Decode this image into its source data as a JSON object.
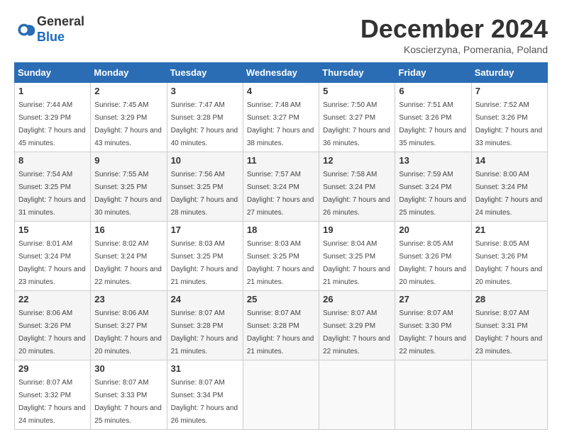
{
  "header": {
    "logo": {
      "line1": "General",
      "line2": "Blue"
    },
    "title": "December 2024",
    "subtitle": "Koscierzyna, Pomerania, Poland"
  },
  "weekdays": [
    "Sunday",
    "Monday",
    "Tuesday",
    "Wednesday",
    "Thursday",
    "Friday",
    "Saturday"
  ],
  "weeks": [
    [
      {
        "day": "1",
        "sunrise": "7:44 AM",
        "sunset": "3:29 PM",
        "daylight": "7 hours and 45 minutes."
      },
      {
        "day": "2",
        "sunrise": "7:45 AM",
        "sunset": "3:29 PM",
        "daylight": "7 hours and 43 minutes."
      },
      {
        "day": "3",
        "sunrise": "7:47 AM",
        "sunset": "3:28 PM",
        "daylight": "7 hours and 40 minutes."
      },
      {
        "day": "4",
        "sunrise": "7:48 AM",
        "sunset": "3:27 PM",
        "daylight": "7 hours and 38 minutes."
      },
      {
        "day": "5",
        "sunrise": "7:50 AM",
        "sunset": "3:27 PM",
        "daylight": "7 hours and 36 minutes."
      },
      {
        "day": "6",
        "sunrise": "7:51 AM",
        "sunset": "3:26 PM",
        "daylight": "7 hours and 35 minutes."
      },
      {
        "day": "7",
        "sunrise": "7:52 AM",
        "sunset": "3:26 PM",
        "daylight": "7 hours and 33 minutes."
      }
    ],
    [
      {
        "day": "8",
        "sunrise": "7:54 AM",
        "sunset": "3:25 PM",
        "daylight": "7 hours and 31 minutes."
      },
      {
        "day": "9",
        "sunrise": "7:55 AM",
        "sunset": "3:25 PM",
        "daylight": "7 hours and 30 minutes."
      },
      {
        "day": "10",
        "sunrise": "7:56 AM",
        "sunset": "3:25 PM",
        "daylight": "7 hours and 28 minutes."
      },
      {
        "day": "11",
        "sunrise": "7:57 AM",
        "sunset": "3:24 PM",
        "daylight": "7 hours and 27 minutes."
      },
      {
        "day": "12",
        "sunrise": "7:58 AM",
        "sunset": "3:24 PM",
        "daylight": "7 hours and 26 minutes."
      },
      {
        "day": "13",
        "sunrise": "7:59 AM",
        "sunset": "3:24 PM",
        "daylight": "7 hours and 25 minutes."
      },
      {
        "day": "14",
        "sunrise": "8:00 AM",
        "sunset": "3:24 PM",
        "daylight": "7 hours and 24 minutes."
      }
    ],
    [
      {
        "day": "15",
        "sunrise": "8:01 AM",
        "sunset": "3:24 PM",
        "daylight": "7 hours and 23 minutes."
      },
      {
        "day": "16",
        "sunrise": "8:02 AM",
        "sunset": "3:24 PM",
        "daylight": "7 hours and 22 minutes."
      },
      {
        "day": "17",
        "sunrise": "8:03 AM",
        "sunset": "3:25 PM",
        "daylight": "7 hours and 21 minutes."
      },
      {
        "day": "18",
        "sunrise": "8:03 AM",
        "sunset": "3:25 PM",
        "daylight": "7 hours and 21 minutes."
      },
      {
        "day": "19",
        "sunrise": "8:04 AM",
        "sunset": "3:25 PM",
        "daylight": "7 hours and 21 minutes."
      },
      {
        "day": "20",
        "sunrise": "8:05 AM",
        "sunset": "3:26 PM",
        "daylight": "7 hours and 20 minutes."
      },
      {
        "day": "21",
        "sunrise": "8:05 AM",
        "sunset": "3:26 PM",
        "daylight": "7 hours and 20 minutes."
      }
    ],
    [
      {
        "day": "22",
        "sunrise": "8:06 AM",
        "sunset": "3:26 PM",
        "daylight": "7 hours and 20 minutes."
      },
      {
        "day": "23",
        "sunrise": "8:06 AM",
        "sunset": "3:27 PM",
        "daylight": "7 hours and 20 minutes."
      },
      {
        "day": "24",
        "sunrise": "8:07 AM",
        "sunset": "3:28 PM",
        "daylight": "7 hours and 21 minutes."
      },
      {
        "day": "25",
        "sunrise": "8:07 AM",
        "sunset": "3:28 PM",
        "daylight": "7 hours and 21 minutes."
      },
      {
        "day": "26",
        "sunrise": "8:07 AM",
        "sunset": "3:29 PM",
        "daylight": "7 hours and 22 minutes."
      },
      {
        "day": "27",
        "sunrise": "8:07 AM",
        "sunset": "3:30 PM",
        "daylight": "7 hours and 22 minutes."
      },
      {
        "day": "28",
        "sunrise": "8:07 AM",
        "sunset": "3:31 PM",
        "daylight": "7 hours and 23 minutes."
      }
    ],
    [
      {
        "day": "29",
        "sunrise": "8:07 AM",
        "sunset": "3:32 PM",
        "daylight": "7 hours and 24 minutes."
      },
      {
        "day": "30",
        "sunrise": "8:07 AM",
        "sunset": "3:33 PM",
        "daylight": "7 hours and 25 minutes."
      },
      {
        "day": "31",
        "sunrise": "8:07 AM",
        "sunset": "3:34 PM",
        "daylight": "7 hours and 26 minutes."
      },
      null,
      null,
      null,
      null
    ]
  ]
}
